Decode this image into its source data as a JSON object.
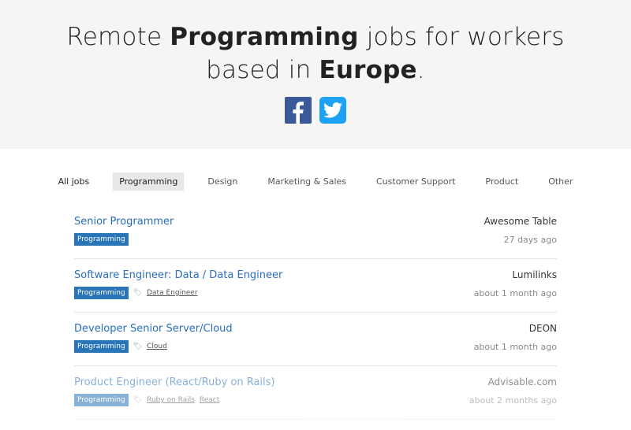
{
  "hero": {
    "line1_pre": "Remote ",
    "line1_bold": "Programming",
    "line1_post": " jobs for workers",
    "line2_pre": "based in ",
    "line2_bold": "Europe",
    "line2_post": ".",
    "social": [
      {
        "name": "facebook-icon",
        "color": "#3b5998"
      },
      {
        "name": "twitter-icon",
        "color": "#1da1f2"
      }
    ]
  },
  "tabs": [
    "All jobs",
    "Programming",
    "Design",
    "Marketing & Sales",
    "Customer Support",
    "Product",
    "Other"
  ],
  "active_tab": "Programming",
  "jobs": [
    {
      "title": "Senior Programmer",
      "category": "Programming",
      "tags": [],
      "company": "Awesome Table",
      "time": "27 days ago"
    },
    {
      "title": "Software Engineer: Data / Data Engineer",
      "category": "Programming",
      "tags": [
        "Data Engineer"
      ],
      "company": "Lumilinks",
      "time": "about 1 month ago"
    },
    {
      "title": "Developer Senior Server/Cloud",
      "category": "Programming",
      "tags": [
        "Cloud"
      ],
      "company": "DEON",
      "time": "about 1 month ago"
    },
    {
      "title": "Product Engineer (React/Ruby on Rails)",
      "category": "Programming",
      "tags": [
        "Ruby on Rails",
        "React"
      ],
      "company": "Advisable.com",
      "time": "about 2 months ago"
    }
  ]
}
